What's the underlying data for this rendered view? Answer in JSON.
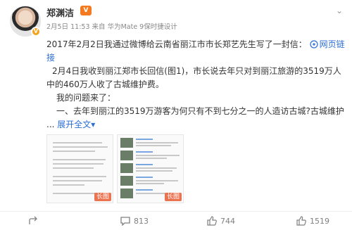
{
  "user": {
    "name": "郑渊洁",
    "vip_badge": "V",
    "time": "2月5日 11:53",
    "source_prefix": "来自",
    "source": "华为Mate 9保时捷设计"
  },
  "post": {
    "line1_text": "2017年2月2日我通过微博给云南省丽江市市长郑艺先生写了一封信：",
    "web_link": "网页链",
    "web_link_tail": "接",
    "line3": "2月4日我收到丽江郑市长回信(图1)，市长说去年只对到丽江旅游的3519万人",
    "line4": "中的460万人收了古城维护费。",
    "line5": "我的问题来了：",
    "line6": "一、去年到丽江的3519万游客为何只有不到七分之一的人造访古城?古城维护",
    "ellipsis": "...",
    "expand": "展开全文",
    "expand_arrow": "▾"
  },
  "thumbs": [
    {
      "tag": "长图"
    },
    {
      "tag": "长图"
    }
  ],
  "actions": {
    "share_count": "",
    "comment_count": "813",
    "like_count": "744",
    "extra_count": "1519"
  },
  "colors": {
    "link": "#eb7350",
    "blue": "#2c6ed5",
    "muted": "#808080"
  }
}
